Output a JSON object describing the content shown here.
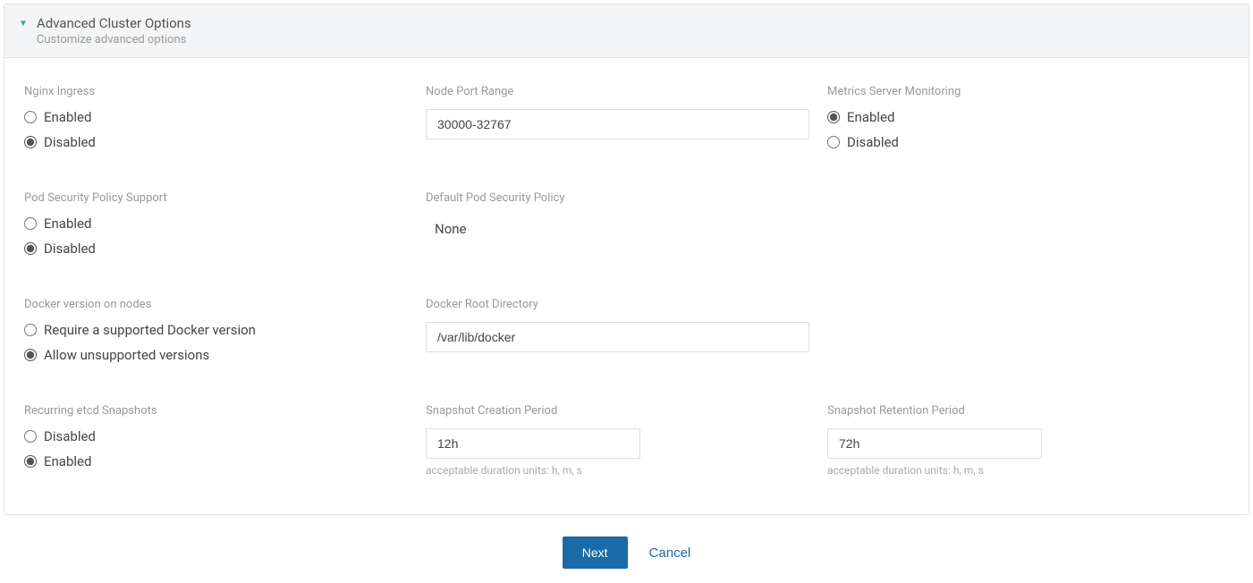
{
  "header": {
    "title": "Advanced Cluster Options",
    "subtitle": "Customize advanced options"
  },
  "sections": {
    "nginxIngress": {
      "label": "Nginx Ingress",
      "optEnabled": "Enabled",
      "optDisabled": "Disabled"
    },
    "nodePortRange": {
      "label": "Node Port Range",
      "value": "30000-32767"
    },
    "metricsServer": {
      "label": "Metrics Server Monitoring",
      "optEnabled": "Enabled",
      "optDisabled": "Disabled"
    },
    "podSecurityPolicy": {
      "label": "Pod Security Policy Support",
      "optEnabled": "Enabled",
      "optDisabled": "Disabled"
    },
    "defaultPodSecurityPolicy": {
      "label": "Default Pod Security Policy",
      "value": "None"
    },
    "dockerVersion": {
      "label": "Docker version on nodes",
      "optRequire": "Require a supported Docker version",
      "optAllow": "Allow unsupported versions"
    },
    "dockerRootDir": {
      "label": "Docker Root Directory",
      "value": "/var/lib/docker"
    },
    "recurringSnapshots": {
      "label": "Recurring etcd Snapshots",
      "optDisabled": "Disabled",
      "optEnabled": "Enabled"
    },
    "snapshotCreation": {
      "label": "Snapshot Creation Period",
      "value": "12h",
      "helper": "acceptable duration units: h, m, s"
    },
    "snapshotRetention": {
      "label": "Snapshot Retention Period",
      "value": "72h",
      "helper": "acceptable duration units: h, m, s"
    }
  },
  "footer": {
    "next": "Next",
    "cancel": "Cancel"
  }
}
